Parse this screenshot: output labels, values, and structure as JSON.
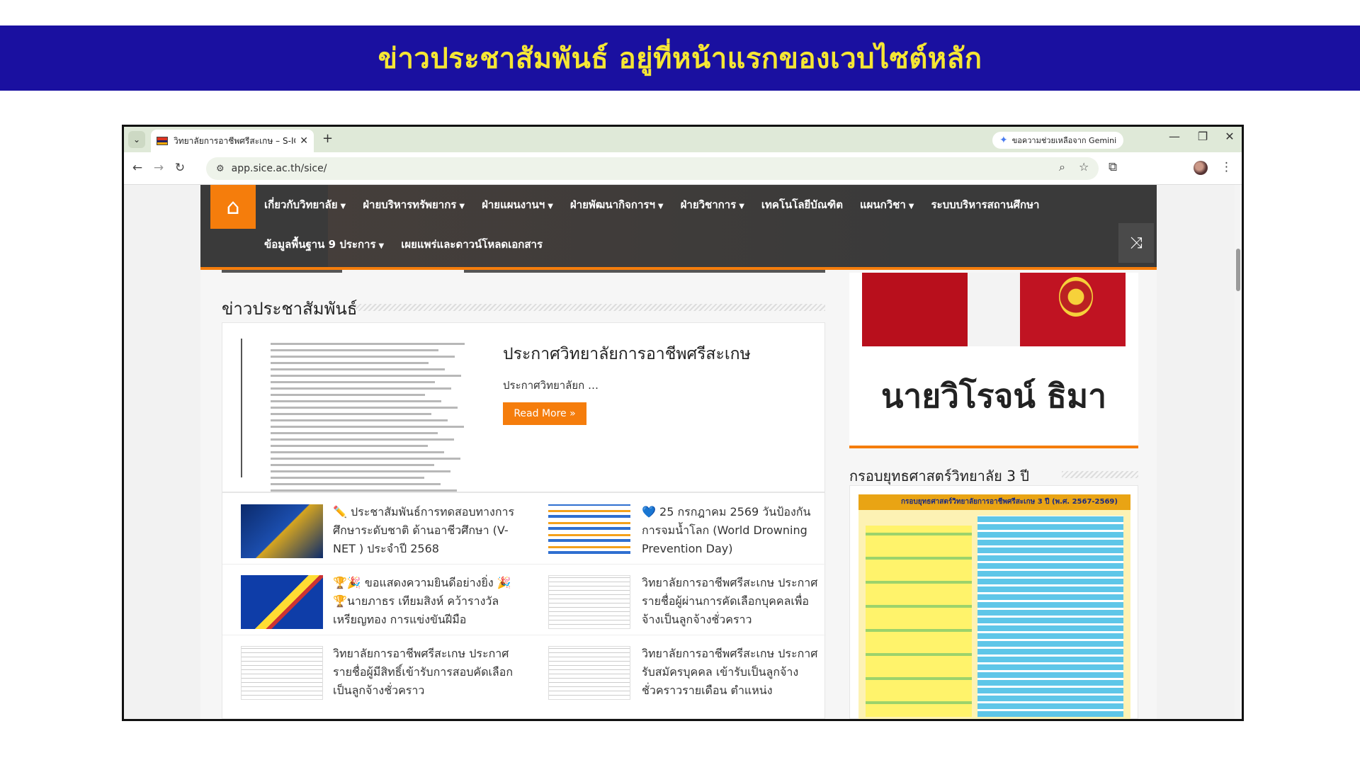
{
  "banner": {
    "title": "ข่าวประชาสัมพันธ์ อยู่ที่หน้าแรกของเวบไซต์หลัก"
  },
  "browser": {
    "tab_title": "วิทยาลัยการอาชีพศรีสะเกษ – S-ICE",
    "gemini_label": "ขอความช่วยเหลือจาก Gemini",
    "url": "app.sice.ac.th/sice/"
  },
  "nav": {
    "row1": [
      {
        "label": "เกี่ยวกับวิทยาลัย",
        "caret": true
      },
      {
        "label": "ฝ่ายบริหารทรัพยากร",
        "caret": true
      },
      {
        "label": "ฝ่ายแผนงานฯ",
        "caret": true
      },
      {
        "label": "ฝ่ายพัฒนากิจการฯ",
        "caret": true
      },
      {
        "label": "ฝ่ายวิชาการ",
        "caret": true
      },
      {
        "label": "เทคโนโลยีบัณฑิต",
        "caret": false
      },
      {
        "label": "แผนกวิชา",
        "caret": true
      },
      {
        "label": "ระบบบริหารสถานศึกษา",
        "caret": false
      }
    ],
    "row2": [
      {
        "label": "ข้อมูลพื้นฐาน 9 ประการ",
        "caret": true
      },
      {
        "label": "เผยแพร่และดาวน์โหลดเอกสาร",
        "caret": false
      }
    ]
  },
  "news": {
    "section_title": "ข่าวประชาสัมพันธ์",
    "featured": {
      "title": "ประกาศวิทยาลัยการอาชีพศรีสะเกษ",
      "excerpt": "ประกาศวิทยาลัยก …",
      "read_more": "Read More »"
    },
    "items": [
      {
        "text": "✏️ ประชาสัมพันธ์การทดสอบทางการศึกษาระดับชาติ ด้านอาชีวศึกษา (V-NET ) ประจำปี 2568",
        "thumb": "th-blue"
      },
      {
        "text": "💙 25 กรกฎาคม 2569 วันป้องกันการจมน้ำโลก (World Drowning Prevention Day)",
        "thumb": "th-info"
      },
      {
        "text": "🏆🎉 ขอแสดงความยินดีอย่างยิ่ง 🎉🏆นายภาธร เทียมสิงห์ คว้ารางวัลเหรียญทอง การแข่งขันฝีมือ",
        "thumb": "th-award"
      },
      {
        "text": "วิทยาลัยการอาชีพศรีสะเกษ ประกาศรายชื่อผู้ผ่านการคัดเลือกบุคคลเพื่อจ้างเป็นลูกจ้างชั่วคราว",
        "thumb": "th-doc"
      },
      {
        "text": "วิทยาลัยการอาชีพศรีสะเกษ ประกาศรายชื่อผู้มีสิทธิ์เข้ารับการสอบคัดเลือกเป็นลูกจ้างชั่วคราว",
        "thumb": "th-doc"
      },
      {
        "text": "วิทยาลัยการอาชีพศรีสะเกษ ประกาศรับสมัครบุคคล เข้ารับเป็นลูกจ้างชั่วคราวรายเดือน ตำแหน่ง",
        "thumb": "th-doc"
      }
    ]
  },
  "sidebar": {
    "person_name": "นายวิโรจน์ ธิมา",
    "strategy_title": "กรอบยุทธศาสตร์วิทยาลัย 3 ปี",
    "strategy_header": "กรอบยุทธศาสตร์วิทยาลัยการอาชีพศรีสะเกษ 3 ปี (พ.ศ. 2567-2569)"
  }
}
